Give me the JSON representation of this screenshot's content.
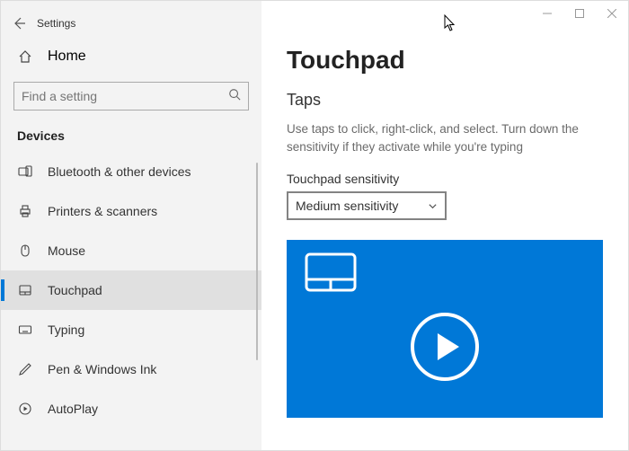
{
  "window": {
    "title": "Settings"
  },
  "sidebar": {
    "home_label": "Home",
    "search_placeholder": "Find a setting",
    "group_label": "Devices",
    "items": [
      {
        "id": "bluetooth",
        "label": "Bluetooth & other devices",
        "icon": "bluetooth-other-icon"
      },
      {
        "id": "printers",
        "label": "Printers & scanners",
        "icon": "printer-icon"
      },
      {
        "id": "mouse",
        "label": "Mouse",
        "icon": "mouse-icon"
      },
      {
        "id": "touchpad",
        "label": "Touchpad",
        "icon": "touchpad-icon",
        "selected": true
      },
      {
        "id": "typing",
        "label": "Typing",
        "icon": "keyboard-icon"
      },
      {
        "id": "pen",
        "label": "Pen & Windows Ink",
        "icon": "pen-icon"
      },
      {
        "id": "autoplay",
        "label": "AutoPlay",
        "icon": "autoplay-icon"
      }
    ]
  },
  "content": {
    "heading": "Touchpad",
    "subheading": "Taps",
    "description": "Use taps to click, right-click, and select. Turn down the sensitivity if they activate while you're typing",
    "sensitivity_label": "Touchpad sensitivity",
    "sensitivity_value": "Medium sensitivity"
  },
  "colors": {
    "accent": "#0078d7"
  }
}
